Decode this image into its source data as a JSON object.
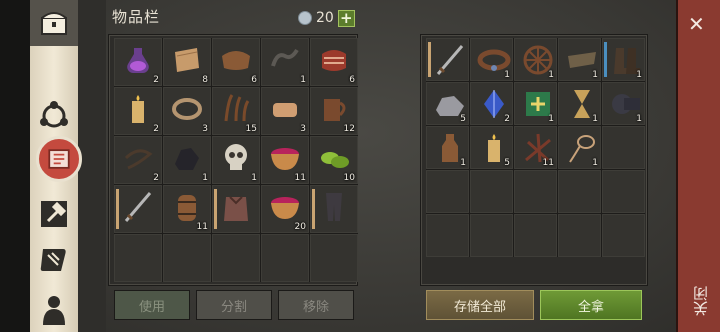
{
  "header": {
    "title": "物品栏",
    "capacity": "20",
    "plus": "+"
  },
  "inventory": {
    "rows": [
      [
        {
          "icon": "potion-icon",
          "count": "2"
        },
        {
          "icon": "cloth-icon",
          "count": "8"
        },
        {
          "icon": "leather-icon",
          "count": "6"
        },
        {
          "icon": "chain-icon",
          "count": "1"
        },
        {
          "icon": "meat-icon",
          "count": "6"
        }
      ],
      [
        {
          "icon": "candle-icon",
          "count": "2"
        },
        {
          "icon": "rope-icon",
          "count": "3"
        },
        {
          "icon": "herb-icon",
          "count": "15"
        },
        {
          "icon": "cloth-bundle-icon",
          "count": "3"
        },
        {
          "icon": "mug-icon",
          "count": "12"
        }
      ],
      [
        {
          "icon": "whip-icon",
          "count": "2"
        },
        {
          "icon": "coal-icon",
          "count": "1"
        },
        {
          "icon": "skull-icon",
          "count": "1"
        },
        {
          "icon": "berry-bowl-icon",
          "count": "11"
        },
        {
          "icon": "green-food-icon",
          "count": "10"
        }
      ],
      [
        {
          "icon": "sword-icon",
          "count": ""
        },
        {
          "icon": "barrel-icon",
          "count": "11"
        },
        {
          "icon": "armor-icon",
          "count": ""
        },
        {
          "icon": "berry-bowl-icon",
          "count": "20"
        },
        {
          "icon": "pants-icon",
          "count": ""
        }
      ],
      [
        {
          "icon": "",
          "count": ""
        },
        {
          "icon": "",
          "count": ""
        },
        {
          "icon": "",
          "count": ""
        },
        {
          "icon": "",
          "count": ""
        },
        {
          "icon": "",
          "count": ""
        }
      ]
    ],
    "buttons": {
      "use": "使用",
      "split": "分割",
      "remove": "移除"
    }
  },
  "storage": {
    "rows": [
      [
        {
          "icon": "sword-icon",
          "count": ""
        },
        {
          "icon": "belt-icon",
          "count": "1"
        },
        {
          "icon": "wheel-icon",
          "count": "1"
        },
        {
          "icon": "tray-icon",
          "count": "1"
        },
        {
          "icon": "boots-icon",
          "count": "1"
        }
      ],
      [
        {
          "icon": "ore-icon",
          "count": "5"
        },
        {
          "icon": "crystal-icon",
          "count": "2"
        },
        {
          "icon": "book-icon",
          "count": "1"
        },
        {
          "icon": "hourglass-icon",
          "count": "1"
        },
        {
          "icon": "tape-icon",
          "count": "1"
        }
      ],
      [
        {
          "icon": "bottle-icon",
          "count": "1"
        },
        {
          "icon": "candle-icon",
          "count": "5"
        },
        {
          "icon": "twigs-icon",
          "count": "11"
        },
        {
          "icon": "lasso-icon",
          "count": "1"
        },
        {
          "icon": "",
          "count": ""
        }
      ],
      [
        {
          "icon": "",
          "count": ""
        },
        {
          "icon": "",
          "count": ""
        },
        {
          "icon": "",
          "count": ""
        },
        {
          "icon": "",
          "count": ""
        },
        {
          "icon": "",
          "count": ""
        }
      ],
      [
        {
          "icon": "",
          "count": ""
        },
        {
          "icon": "",
          "count": ""
        },
        {
          "icon": "",
          "count": ""
        },
        {
          "icon": "",
          "count": ""
        },
        {
          "icon": "",
          "count": ""
        }
      ]
    ],
    "buttons": {
      "store_all": "存储全部",
      "take_all": "全拿"
    }
  },
  "close": {
    "x": "✕",
    "label": "关闭"
  }
}
